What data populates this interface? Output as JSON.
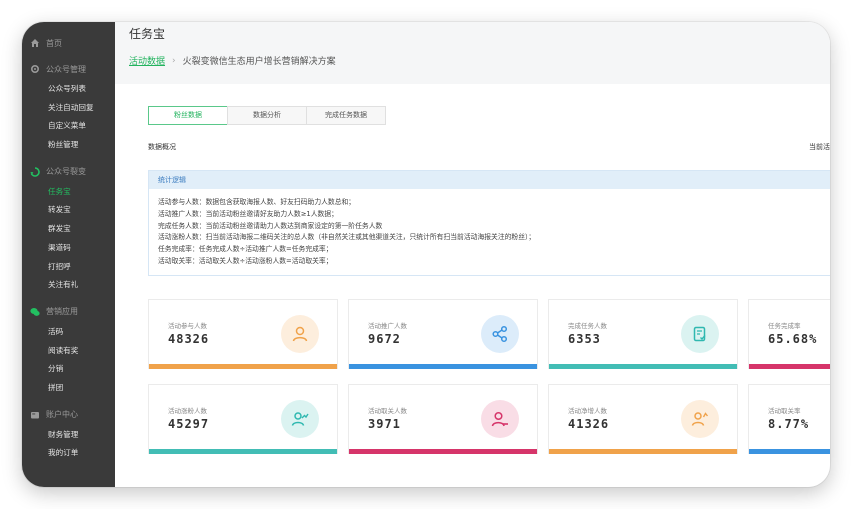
{
  "sidebar": {
    "home": "首页",
    "groups": [
      {
        "label": "公众号管理",
        "items": [
          "公众号列表",
          "关注自动回复",
          "自定义菜单",
          "粉丝管理"
        ]
      },
      {
        "label": "公众号裂变",
        "items": [
          "任务宝",
          "转发宝",
          "群发宝",
          "渠道码",
          "打招呼",
          "关注有礼"
        ]
      },
      {
        "label": "营销应用",
        "items": [
          "活码",
          "阅读有奖",
          "分销",
          "拼团"
        ]
      },
      {
        "label": "账户中心",
        "items": [
          "财务管理",
          "我的订单"
        ]
      }
    ],
    "active_item": "任务宝"
  },
  "header": {
    "title": "任务宝",
    "breadcrumb_link": "活动数据",
    "breadcrumb_sep": "›",
    "breadcrumb_current": "火裂变微信生态用户增长营销解决方案"
  },
  "tabs": [
    "粉丝数据",
    "数据分析",
    "完成任务数据"
  ],
  "overview": {
    "label": "数据概况",
    "right_text": "当前活"
  },
  "logic": {
    "title": "统计逻辑",
    "lines": [
      "活动参与人数：数据包含获取海报人数、好友扫码助力人数总和；",
      "活动推广人数：当前活动粉丝邀请好友助力人数≥1人数据；",
      "完成任务人数：当前活动粉丝邀请助力人数达到商家设定的第一阶任务人数",
      "活动涨粉人数：扫当前活动海报二维码关注的总人数（非自然关注或其他渠道关注，只统计所有扫当前活动海报关注的粉丝）；",
      "任务完成率：任务完成人数÷活动推广人数=任务完成率；",
      "活动取关率：活动取关人数÷活动涨粉人数=活动取关率；"
    ]
  },
  "stats": [
    {
      "label": "活动参与人数",
      "value": "48326",
      "icon": "user-icon",
      "icon_color": "#f0a24a",
      "icon_bg": "#fdeedd",
      "bar": "#f0a24a"
    },
    {
      "label": "活动推广人数",
      "value": "9672",
      "icon": "share-icon",
      "icon_color": "#3a93e0",
      "icon_bg": "#dcecfa",
      "bar": "#3a93e0"
    },
    {
      "label": "完成任务人数",
      "value": "6353",
      "icon": "task-icon",
      "icon_color": "#2fb8b0",
      "icon_bg": "#dbf3f1",
      "bar": "#42bdb5"
    },
    {
      "label": "任务完成率",
      "value": "65.68%",
      "icon": "",
      "icon_color": "",
      "icon_bg": "",
      "bar": "#d6356a"
    },
    {
      "label": "活动涨粉人数",
      "value": "45297",
      "icon": "growth-icon",
      "icon_color": "#2fb8b0",
      "icon_bg": "#dbf3f1",
      "bar": "#42bdb5"
    },
    {
      "label": "活动取关人数",
      "value": "3971",
      "icon": "user-remove-icon",
      "icon_color": "#d6356a",
      "icon_bg": "#f9dde6",
      "bar": "#d6356a"
    },
    {
      "label": "活动净增人数",
      "value": "41326",
      "icon": "user-add-icon",
      "icon_color": "#f0a24a",
      "icon_bg": "#fdeedd",
      "bar": "#f0a24a"
    },
    {
      "label": "活动取关率",
      "value": "8.77%",
      "icon": "",
      "icon_color": "",
      "icon_bg": "",
      "bar": "#3a93e0"
    }
  ]
}
